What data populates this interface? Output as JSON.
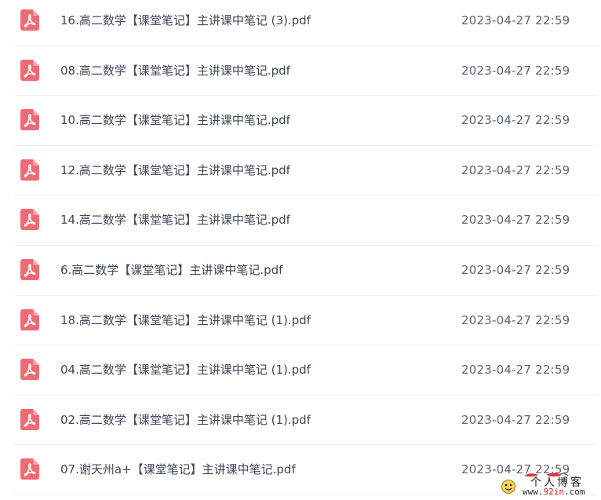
{
  "colors": {
    "pdf_icon": "#f06a73",
    "file_name_text": "#3f4656",
    "date_text": "#5d6470",
    "divider": "#eef0f3"
  },
  "files": [
    {
      "name": "16.高二数学【课堂笔记】主讲课中笔记 (3).pdf",
      "date": "2023-04-27 22:59",
      "icon": "pdf-file-icon"
    },
    {
      "name": "08.高二数学【课堂笔记】主讲课中笔记.pdf",
      "date": "2023-04-27 22:59",
      "icon": "pdf-file-icon"
    },
    {
      "name": "10.高二数学【课堂笔记】主讲课中笔记.pdf",
      "date": "2023-04-27 22:59",
      "icon": "pdf-file-icon"
    },
    {
      "name": "12.高二数学【课堂笔记】主讲课中笔记.pdf",
      "date": "2023-04-27 22:59",
      "icon": "pdf-file-icon"
    },
    {
      "name": "14.高二数学【课堂笔记】主讲课中笔记.pdf",
      "date": "2023-04-27 22:59",
      "icon": "pdf-file-icon"
    },
    {
      "name": "6.高二数学【课堂笔记】主讲课中笔记.pdf",
      "date": "2023-04-27 22:59",
      "icon": "pdf-file-icon"
    },
    {
      "name": "18.高二数学【课堂笔记】主讲课中笔记 (1).pdf",
      "date": "2023-04-27 22:59",
      "icon": "pdf-file-icon"
    },
    {
      "name": "04.高二数学【课堂笔记】主讲课中笔记 (1).pdf",
      "date": "2023-04-27 22:59",
      "icon": "pdf-file-icon"
    },
    {
      "name": "02.高二数学【课堂笔记】主讲课中笔记 (1).pdf",
      "date": "2023-04-27 22:59",
      "icon": "pdf-file-icon"
    },
    {
      "name": "07.谢天州a+【课堂笔记】主讲课中笔记.pdf",
      "date": "2023-04-27 22:59",
      "icon": "pdf-file-icon"
    }
  ],
  "watermark": {
    "title": "个人博客",
    "url_prefix": "www.",
    "url_highlight": "92in",
    "url_suffix": ".com"
  }
}
